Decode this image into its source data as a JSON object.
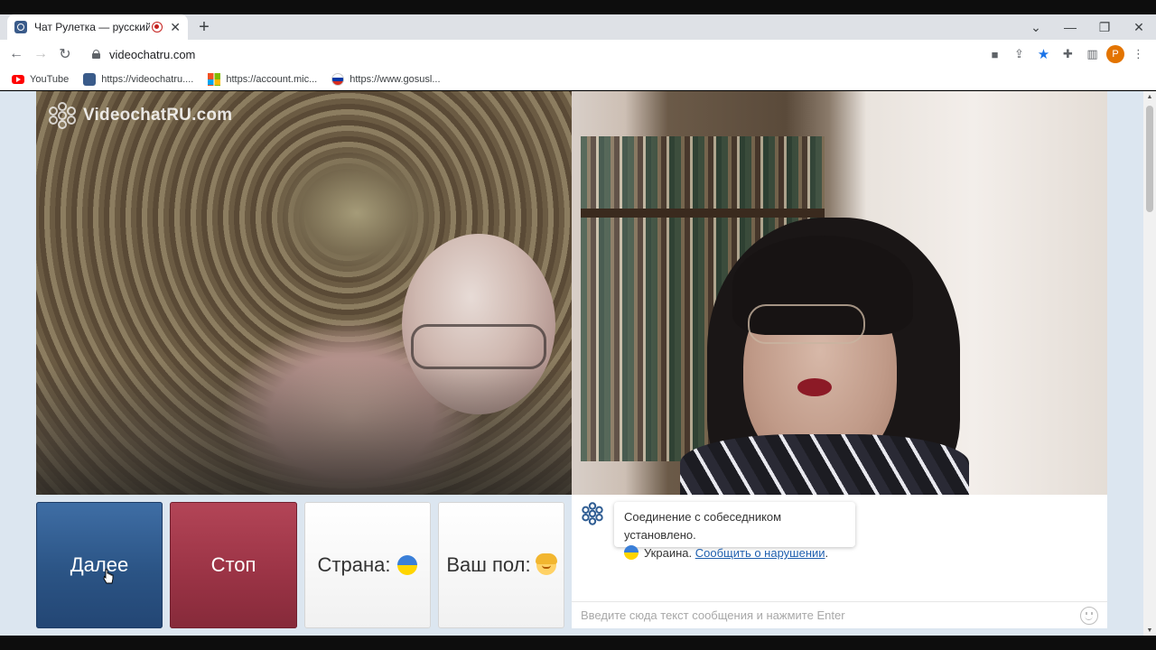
{
  "browser": {
    "tab_title": "Чат Рулетка — русский вид",
    "url": "videochatru.com",
    "bookmarks": [
      {
        "label": "YouTube",
        "icon": "youtube-icon"
      },
      {
        "label": "https://videochatru....",
        "icon": "videochat-icon"
      },
      {
        "label": "https://account.mic...",
        "icon": "microsoft-icon"
      },
      {
        "label": "https://www.gosusl...",
        "icon": "gosuslugi-icon"
      }
    ],
    "profile_initial": "P",
    "accent": "#1a73e8"
  },
  "video": {
    "logo_text": "VideochatRU.com"
  },
  "controls": {
    "next_label": "Далее",
    "stop_label": "Стоп",
    "country_label": "Страна:",
    "gender_label": "Ваш пол:",
    "next_color": "#2b5485",
    "stop_color": "#9c3446"
  },
  "chat": {
    "connected_message": "Соединение с собеседником установлено.",
    "country_name": "Украина.",
    "report_link": "Сообщить о нарушении",
    "report_suffix": ".",
    "input_placeholder": "Введите сюда текст сообщения и нажмите Enter"
  }
}
